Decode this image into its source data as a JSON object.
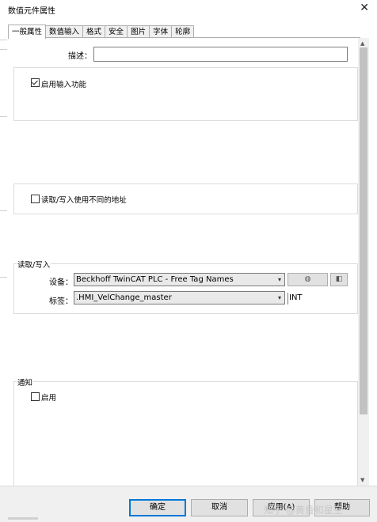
{
  "window": {
    "title": "数值元件属性",
    "close_glyph": "✕"
  },
  "tabs": [
    {
      "label": "一般属性",
      "active": true
    },
    {
      "label": "数值输入",
      "active": false
    },
    {
      "label": "格式",
      "active": false
    },
    {
      "label": "安全",
      "active": false
    },
    {
      "label": "图片",
      "active": false
    },
    {
      "label": "字体",
      "active": false
    },
    {
      "label": "轮廓",
      "active": false
    }
  ],
  "general": {
    "description_label": "描述：",
    "description_value": "",
    "enable_input_label": "启用输入功能",
    "enable_input_checked": true,
    "separate_rw_label": "读取/写入使用不同的地址",
    "separate_rw_checked": false
  },
  "readwrite": {
    "group_title": "读取/写入",
    "device_label": "设备：",
    "device_value": "Beckhoff TwinCAT PLC - Free Tag Names",
    "tag_label": "标签：",
    "tag_value": ".HMI_VelChange_master",
    "type_value": "INT"
  },
  "notify": {
    "group_title": "通知",
    "enable_label": "启用",
    "enable_checked": false
  },
  "buttons": {
    "ok": "确定",
    "cancel": "取消",
    "apply": "应用(A)",
    "help": "帮助"
  },
  "watermark": "知乎 @黄昏和星空",
  "icons": {
    "device_settings": "device-settings-icon",
    "tag_browse": "tag-browse-icon"
  }
}
